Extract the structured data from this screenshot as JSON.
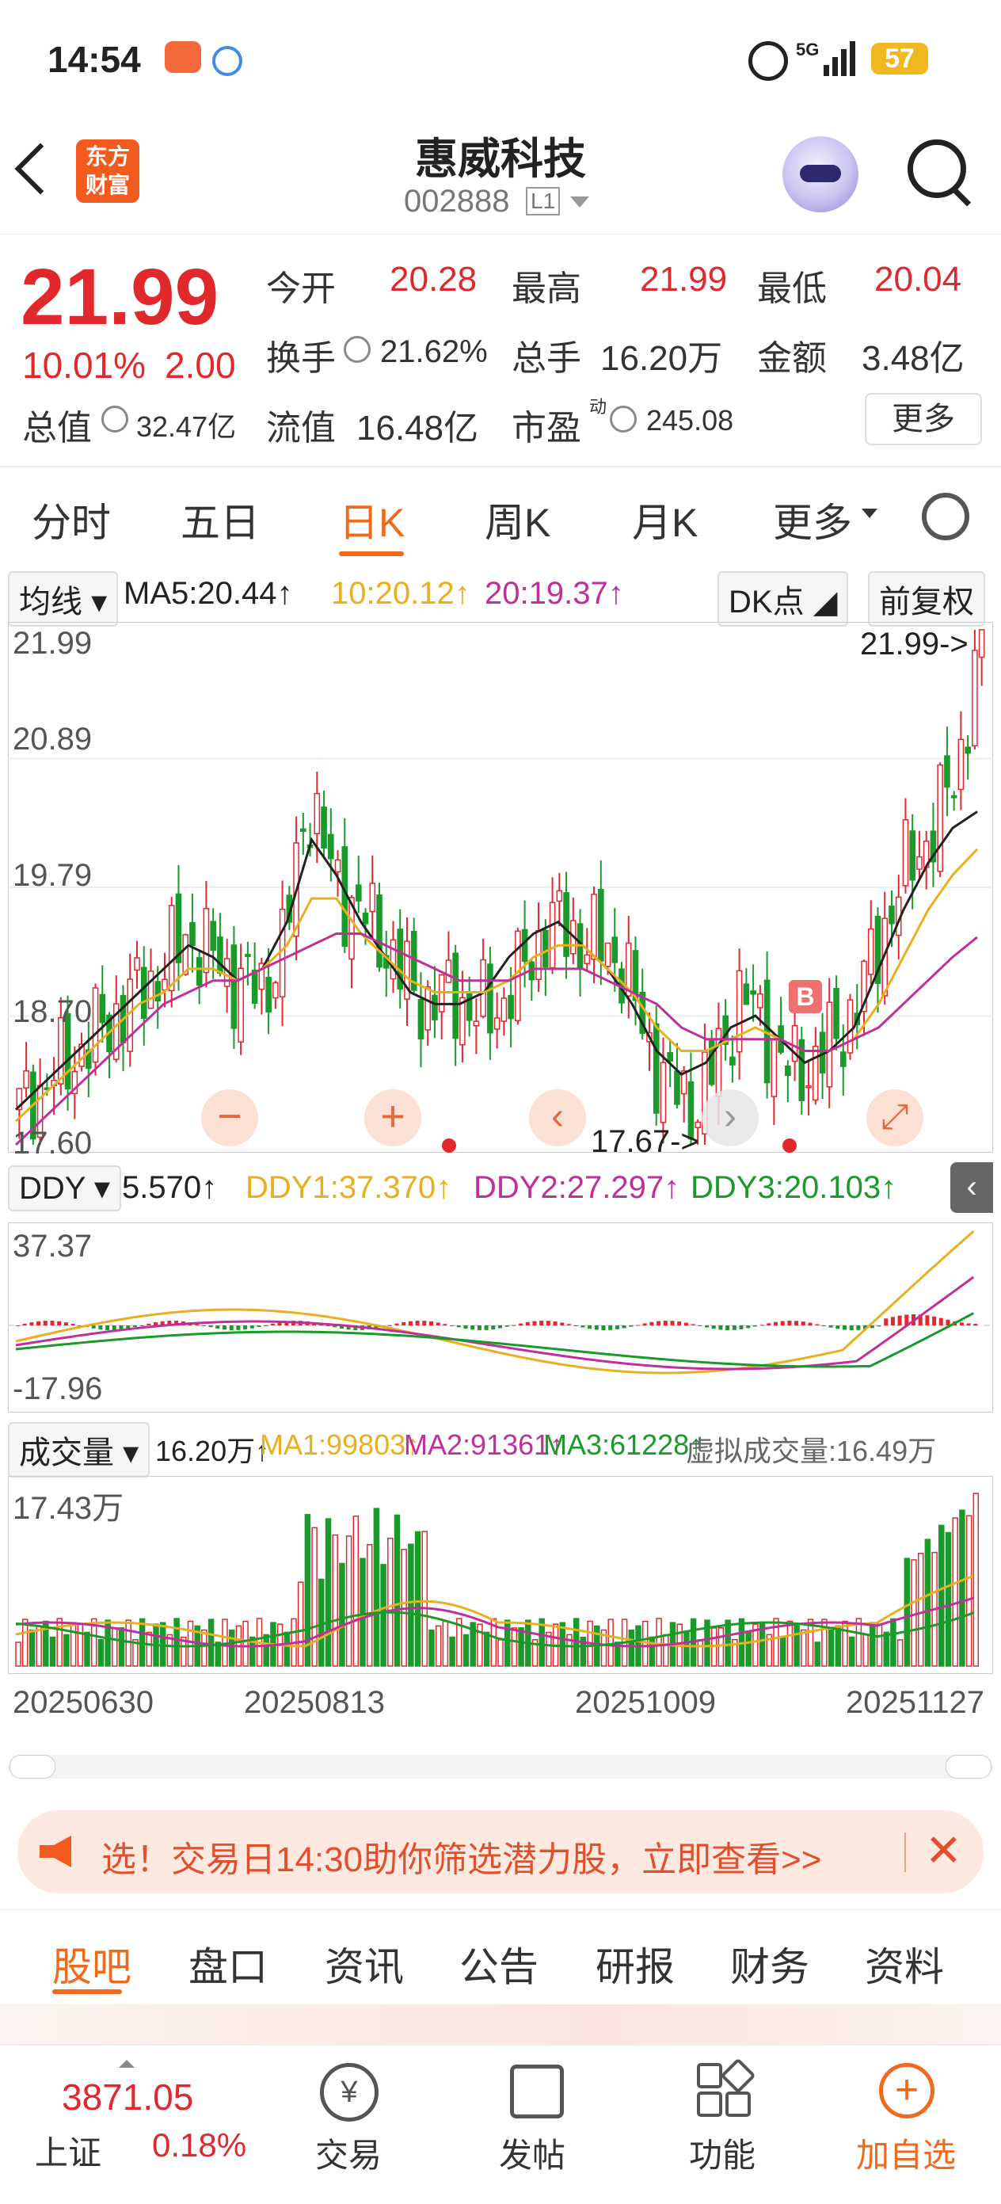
{
  "status": {
    "time": "14:54",
    "battery": "57",
    "net": "5G"
  },
  "header": {
    "logo_line1": "东方",
    "logo_line2": "财富",
    "title": "惠威科技",
    "code": "002888",
    "level": "L1"
  },
  "quote": {
    "price": "21.99",
    "change_pct": "10.01%",
    "change_abs": "2.00",
    "open_label": "今开",
    "open": "20.28",
    "high_label": "最高",
    "high": "21.99",
    "low_label": "最低",
    "low": "20.04",
    "turnover_label": "换手",
    "turnover": "21.62%",
    "volume_label": "总手",
    "volume": "16.20万",
    "amount_label": "金额",
    "amount": "3.48亿",
    "mktcap_label": "总值",
    "mktcap": "32.47亿",
    "float_label": "流值",
    "float": "16.48亿",
    "pe_label": "市盈",
    "pe_sup": "动",
    "pe": "245.08",
    "more": "更多"
  },
  "period_tabs": [
    "分时",
    "五日",
    "日K",
    "周K",
    "月K",
    "更多"
  ],
  "chart": {
    "ma_selector": "均线",
    "ma5": "MA5:20.44↑",
    "ma10": "10:20.12↑",
    "ma20": "20:19.37↑",
    "dk_label": "DK点",
    "adjust_label": "前复权",
    "y_labels": [
      "21.99",
      "20.89",
      "19.79",
      "18.70",
      "17.60"
    ],
    "high_marker": "21.99->",
    "low_marker": "17.67->",
    "b_marker": "B",
    "ddy_selector": "DDY",
    "ddy": "5.570↑",
    "ddy1": "DDY1:37.370↑",
    "ddy2": "DDY2:27.297↑",
    "ddy3": "DDY3:20.103↑",
    "ddy_top": "37.37",
    "ddy_bottom": "-17.96",
    "vol_selector": "成交量",
    "vol": "16.20万↑",
    "vol_ma1": "MA1:99803↑",
    "vol_ma2": "MA2:91361↑",
    "vol_ma3": "MA3:61228↑",
    "vol_virtual": "虚拟成交量:16.49万",
    "vol_top": "17.43万",
    "dates": [
      "20250630",
      "20250813",
      "20251009",
      "20251127"
    ]
  },
  "chart_data": {
    "type": "candlestick",
    "ylim": [
      17.6,
      21.99
    ],
    "close_trend": [
      17.9,
      18.1,
      18.3,
      18.5,
      18.7,
      18.9,
      19.1,
      19.4,
      19.2,
      19.0,
      18.9,
      19.3,
      20.6,
      19.9,
      19.6,
      19.4,
      19.0,
      18.8,
      18.9,
      18.7,
      18.8,
      19.1,
      19.5,
      19.4,
      19.3,
      19.2,
      18.5,
      18.1,
      17.9,
      18.3,
      18.9,
      18.6,
      18.2,
      18.3,
      18.5,
      18.9,
      19.5,
      20.0,
      20.3,
      20.8,
      21.99
    ],
    "ma_series": [
      {
        "name": "MA5",
        "color": "#222222",
        "values": [
          17.9,
          18.1,
          18.3,
          18.5,
          18.7,
          18.9,
          19.1,
          19.3,
          19.2,
          19.0,
          19.1,
          19.5,
          20.2,
          19.9,
          19.5,
          19.2,
          18.9,
          18.8,
          18.8,
          18.9,
          19.2,
          19.4,
          19.5,
          19.3,
          19.1,
          18.8,
          18.4,
          18.2,
          18.3,
          18.6,
          18.7,
          18.5,
          18.3,
          18.4,
          18.6,
          19.1,
          19.6,
          20.0,
          20.3,
          20.44
        ]
      },
      {
        "name": "MA10",
        "color": "#e8b020",
        "values": [
          17.8,
          18.0,
          18.2,
          18.4,
          18.6,
          18.8,
          18.9,
          19.1,
          19.1,
          19.0,
          19.1,
          19.3,
          19.7,
          19.7,
          19.4,
          19.2,
          19.0,
          18.9,
          18.9,
          18.9,
          19.0,
          19.2,
          19.3,
          19.3,
          19.1,
          18.9,
          18.6,
          18.4,
          18.4,
          18.5,
          18.6,
          18.5,
          18.4,
          18.4,
          18.5,
          18.8,
          19.2,
          19.6,
          19.9,
          20.12
        ]
      },
      {
        "name": "MA20",
        "color": "#c0309a",
        "values": [
          17.6,
          17.8,
          18.0,
          18.2,
          18.4,
          18.6,
          18.8,
          18.9,
          19.0,
          19.0,
          19.1,
          19.2,
          19.3,
          19.4,
          19.4,
          19.3,
          19.2,
          19.1,
          19.0,
          19.0,
          19.0,
          19.1,
          19.1,
          19.1,
          19.0,
          18.9,
          18.8,
          18.6,
          18.5,
          18.5,
          18.5,
          18.5,
          18.4,
          18.4,
          18.5,
          18.6,
          18.8,
          19.0,
          19.2,
          19.37
        ]
      }
    ],
    "dates": [
      "20250630",
      "20250813",
      "20251009",
      "20251127"
    ]
  },
  "news": {
    "text": "选！交易日14:30助你筛选潜力股，立即查看>>"
  },
  "bottom_tabs": [
    "股吧",
    "盘口",
    "资讯",
    "公告",
    "研报",
    "财务",
    "资料"
  ],
  "navbar": {
    "index_value": "3871.05",
    "index_name": "上证",
    "index_change": "0.18%",
    "trade": "交易",
    "post": "发帖",
    "functions": "功能",
    "add_watch": "加自选"
  },
  "colors": {
    "up": "#e0282d",
    "down": "#1a9a2a",
    "accent": "#f06a1e"
  }
}
